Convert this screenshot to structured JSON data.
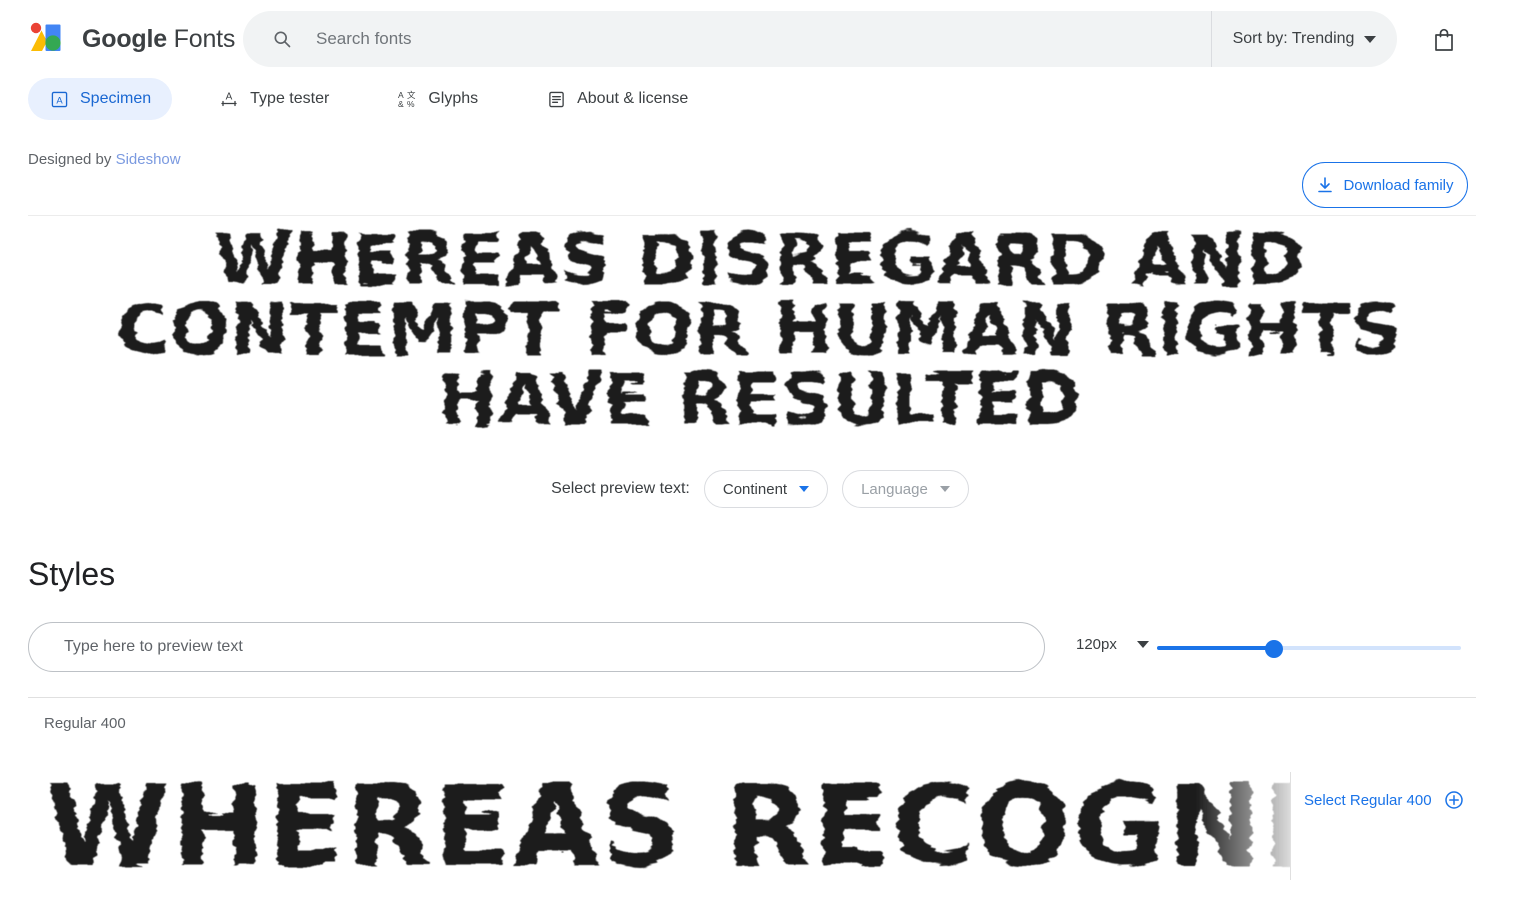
{
  "header": {
    "logo_name": "google-fonts-logo",
    "brand_bold": "Google",
    "brand_light": "Fonts",
    "search": {
      "placeholder": "Search fonts",
      "value": "",
      "icon": "search-icon"
    },
    "sort": {
      "label": "Sort by: Trending",
      "icon": "chevron-down-icon"
    },
    "bag_icon": "shopping-bag-icon"
  },
  "tabs": [
    {
      "label": "Specimen",
      "icon": "specimen-icon",
      "active": true
    },
    {
      "label": "Type tester",
      "icon": "type-tester-icon",
      "active": false
    },
    {
      "label": "Glyphs",
      "icon": "glyphs-icon",
      "active": false
    },
    {
      "label": "About & license",
      "icon": "about-license-icon",
      "active": false
    }
  ],
  "download": {
    "label": "Download family",
    "icon": "download-icon"
  },
  "designer": {
    "prefix": "Designed by ",
    "name": "Sideshow"
  },
  "specimen": {
    "hero_text": "Whereas disregard and contempt for human rights have resulted"
  },
  "preview_select": {
    "label": "Select preview text:",
    "continent": {
      "label": "Continent",
      "icon": "chevron-down-icon",
      "enabled": true
    },
    "language": {
      "label": "Language",
      "icon": "chevron-down-icon",
      "enabled": false
    }
  },
  "styles": {
    "title": "Styles",
    "preview_input": {
      "placeholder": "Type here to preview text",
      "value": ""
    },
    "size": {
      "label": "120px",
      "icon": "chevron-down-icon",
      "value": 120,
      "min": 8,
      "max": 300,
      "percent": 38
    },
    "rows": [
      {
        "name": "Regular 400",
        "preview_text": "Whereas recognition of the",
        "select_label": "Select Regular 400",
        "select_icon": "add-circle-icon"
      }
    ]
  },
  "colors": {
    "accent": "#1a73e8",
    "accent_dark": "#1967d2",
    "accent_light_bg": "#e8f0fe",
    "text_primary": "#202124",
    "text_secondary": "#5f6368",
    "surface_grey": "#f1f3f4",
    "border": "#dadce0"
  }
}
